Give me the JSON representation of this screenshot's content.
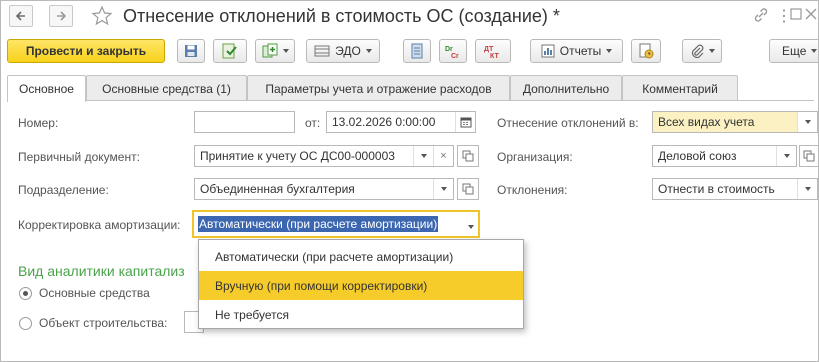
{
  "header": {
    "title": "Отнесение отклонений в стоимость ОС (создание) *"
  },
  "toolbar": {
    "post_close": "Провести и закрыть",
    "edo": "ЭДО",
    "reports": "Отчеты",
    "more": "Еще"
  },
  "tabs": [
    "Основное",
    "Основные средства (1)",
    "Параметры учета и отражение расходов",
    "Дополнительно",
    "Комментарий"
  ],
  "form": {
    "number_label": "Номер:",
    "number_value": "",
    "date_label": "от:",
    "date_value": "13.02.2026  0:00:00",
    "primary_doc_label": "Первичный документ:",
    "primary_doc_value": "Принятие к учету ОС ДС00-000003",
    "department_label": "Подразделение:",
    "department_value": "Объединенная бухгалтерия",
    "amort_label": "Корректировка амортизации:",
    "amort_value": "Автоматически (при расчете амортизации)",
    "deviation_in_label": "Отнесение отклонений в:",
    "deviation_in_value": "Всех видах учета",
    "org_label": "Организация:",
    "org_value": "Деловой союз",
    "deviations_label": "Отклонения:",
    "deviations_value": "Отнести в стоимость",
    "analytics_title": "Вид аналитики капитализ",
    "radio_fixed_assets": "Основные средства",
    "radio_construction": "Объект строительства:"
  },
  "dropdown": {
    "options": [
      "Автоматически (при расчете амортизации)",
      "Вручную (при помощи корректировки)",
      "Не требуется"
    ],
    "highlighted": "Вручную (при помощи корректировки)"
  },
  "colors": {
    "accent": "#f7d21b",
    "highlight": "#f6cc2a",
    "section_green": "#4aa34a",
    "field_yellow": "#fbf1c3"
  }
}
